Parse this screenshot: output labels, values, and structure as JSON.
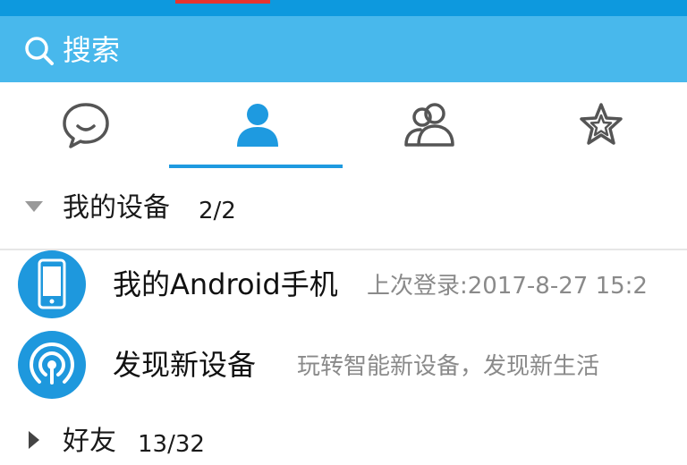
{
  "search": {
    "label": "搜索"
  },
  "tabs": [
    {
      "name": "messages"
    },
    {
      "name": "contacts",
      "selected": true
    },
    {
      "name": "groups"
    },
    {
      "name": "favorites"
    }
  ],
  "groups": {
    "devices": {
      "title": "我的设备",
      "count": "2/2",
      "expanded": true
    },
    "friends": {
      "title": "好友",
      "count": "13/32",
      "expanded": false
    }
  },
  "devices": [
    {
      "name": "我的Android手机",
      "detail": "上次登录:2017-8-27 15:2",
      "icon": "phone-icon"
    },
    {
      "name": "发现新设备",
      "detail": "玩转智能新设备，发现新生活",
      "icon": "radar-icon"
    }
  ],
  "colors": {
    "title_bar": "#0d99de",
    "search_bar": "#48b8ec",
    "accent": "#1e9ae0",
    "tab_icon": "#555555",
    "secondary_text": "#8a8a8a"
  }
}
